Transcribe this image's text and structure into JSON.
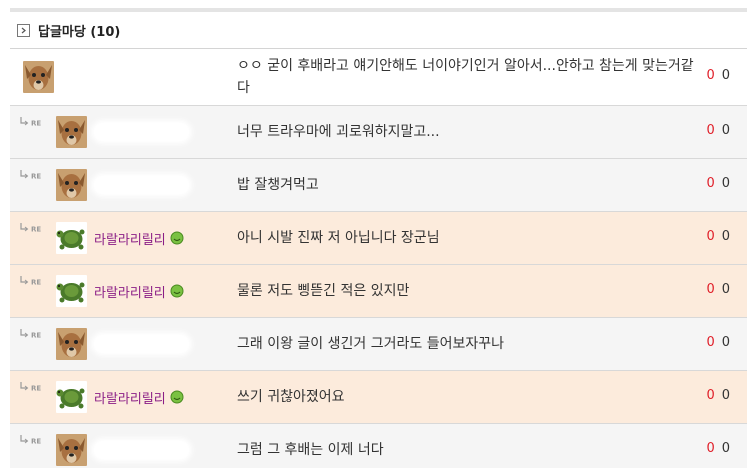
{
  "section": {
    "title": "답글마당 (10)"
  },
  "rows": [
    {
      "type": "main",
      "nick": "",
      "message": "ㅇㅇ 굳이 후배라고 얘기안해도 너이야기인거 알아서...안하고 참는게 맞는거같다",
      "up": "0",
      "down": "0"
    },
    {
      "type": "reply",
      "nick": "",
      "message": "너무 트라우마에 괴로워하지말고...",
      "up": "0",
      "down": "0"
    },
    {
      "type": "reply",
      "nick": "",
      "message": "밥 잘챙겨먹고",
      "up": "0",
      "down": "0"
    },
    {
      "type": "reply",
      "nick": "라랄라리릴리",
      "message": "아니 시발 진짜 저 아닙니다 장군님",
      "up": "0",
      "down": "0"
    },
    {
      "type": "reply",
      "nick": "라랄라리릴리",
      "message": "물론 저도 삥뜯긴 적은 있지만",
      "up": "0",
      "down": "0"
    },
    {
      "type": "reply",
      "nick": "",
      "message": "그래 이왕 글이 생긴거 그거라도 들어보자꾸나",
      "up": "0",
      "down": "0"
    },
    {
      "type": "reply",
      "nick": "라랄라리릴리",
      "message": "쓰기 귀찮아졌어요",
      "up": "0",
      "down": "0"
    },
    {
      "type": "reply",
      "nick": "",
      "message": "그럼 그 후배는 이제 너다",
      "up": "0",
      "down": "0"
    }
  ],
  "colors": {
    "highlight_row": "#fcebdc",
    "upvote": "#e0202a",
    "nick_highlight": "#8b1e86"
  },
  "icons": {
    "toggle": "expand-arrow-icon",
    "reply": "reply-re-icon",
    "badge": "green-circle-badge-icon"
  }
}
